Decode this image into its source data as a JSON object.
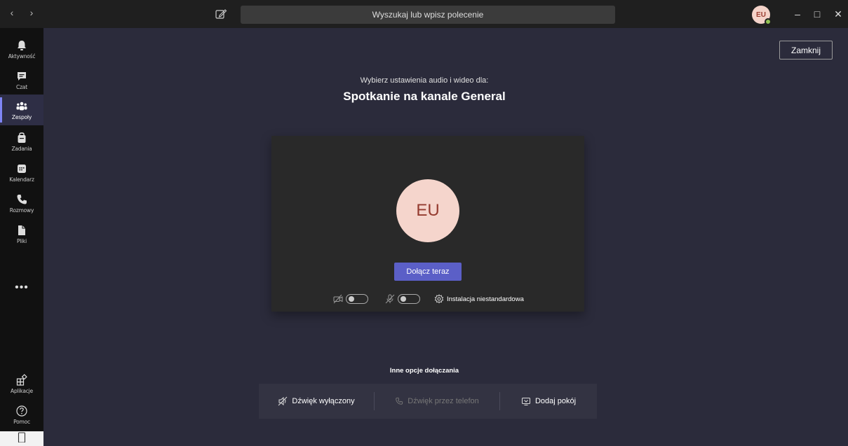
{
  "search": {
    "placeholder": "Wyszukaj lub wpisz polecenie"
  },
  "user": {
    "initials": "EU"
  },
  "window": {
    "minimize": "–",
    "maximize": "□",
    "close": "✕"
  },
  "rail": {
    "items": [
      {
        "label": "Aktywność",
        "icon": "bell-icon"
      },
      {
        "label": "Czat",
        "icon": "chat-icon"
      },
      {
        "label": "Zespoły",
        "icon": "teams-icon",
        "active": true
      },
      {
        "label": "Zadania",
        "icon": "tasks-icon"
      },
      {
        "label": "Kalendarz",
        "icon": "calendar-icon"
      },
      {
        "label": "Rozmowy",
        "icon": "phone-icon"
      },
      {
        "label": "Pliki",
        "icon": "files-icon"
      }
    ],
    "more": "•••",
    "bottom": [
      {
        "label": "Aplikacje",
        "icon": "apps-icon"
      },
      {
        "label": "Pomoc",
        "icon": "help-icon"
      }
    ]
  },
  "main": {
    "close_label": "Zamknij",
    "subtitle": "Wybierz ustawienia audio i wideo dla:",
    "title": "Spotkanie na kanale General",
    "preview": {
      "initials": "EU",
      "join_label": "Dołącz teraz",
      "camera_on": false,
      "mic_on": false,
      "custom_setup_label": "Instalacja niestandardowa"
    },
    "other_options": {
      "heading": "Inne opcje dołączania",
      "audio_off": "Dźwięk wyłączony",
      "phone_audio": "Dźwięk przez telefon",
      "add_room": "Dodaj pokój"
    }
  },
  "colors": {
    "accent": "#5b5fc7",
    "avatar_bg": "#f5d5cc",
    "avatar_text": "#943b2f",
    "presence": "#92c353"
  }
}
